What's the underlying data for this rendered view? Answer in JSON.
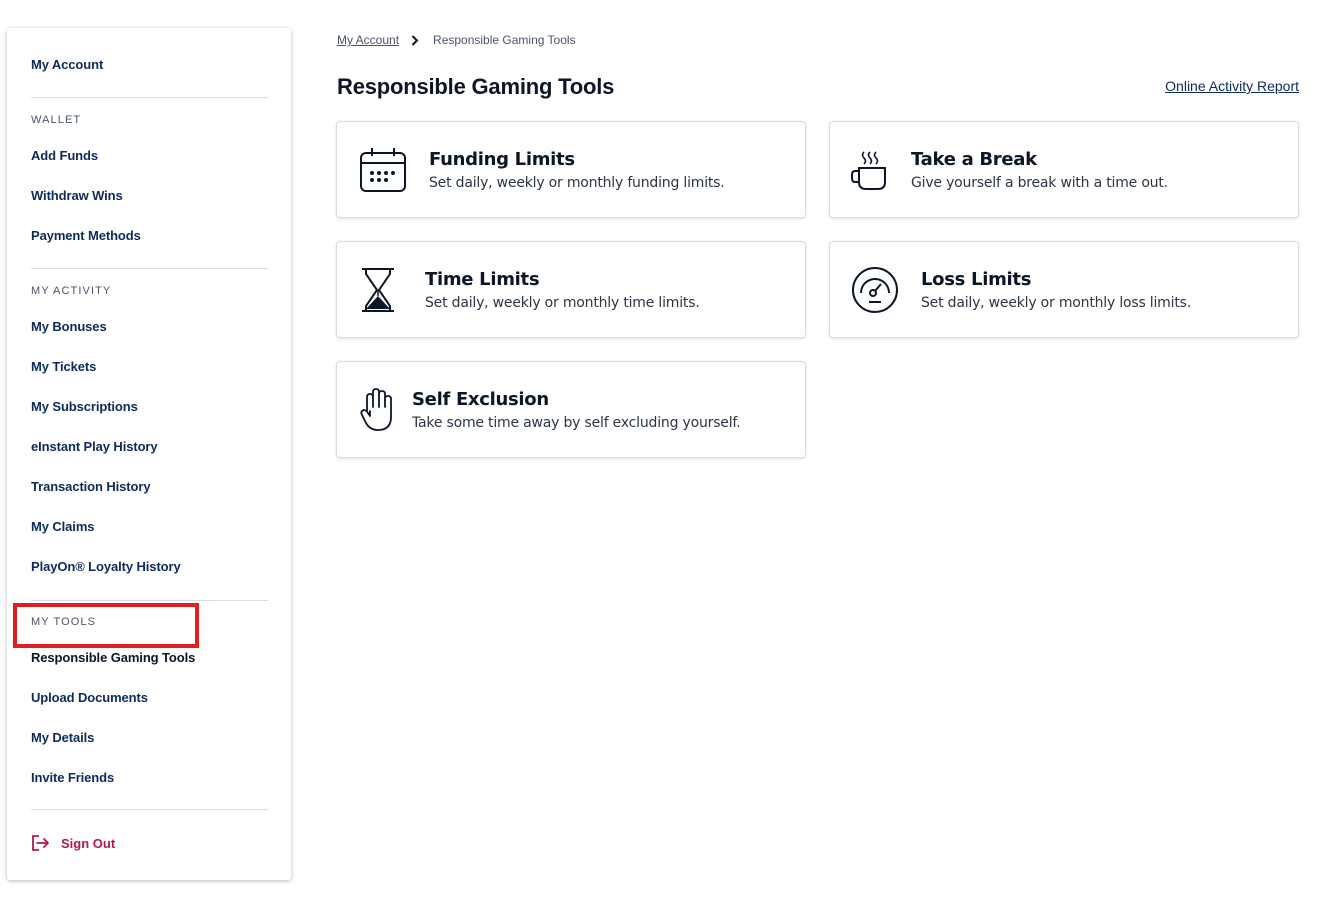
{
  "sidebar": {
    "my_account": "My Account",
    "wallet_heading": "WALLET",
    "wallet_items": [
      "Add Funds",
      "Withdraw Wins",
      "Payment Methods"
    ],
    "activity_heading": "MY ACTIVITY",
    "activity_items": [
      "My Bonuses",
      "My Tickets",
      "My Subscriptions",
      "eInstant Play History",
      "Transaction History",
      "My Claims",
      "PlayOn® Loyalty History"
    ],
    "tools_heading": "MY TOOLS",
    "tools_items": [
      "Responsible Gaming Tools",
      "Upload Documents",
      "My Details",
      "Invite Friends"
    ],
    "sign_out": "Sign Out",
    "active_item": "Responsible Gaming Tools"
  },
  "breadcrumb": {
    "parent": "My Account",
    "current": "Responsible Gaming Tools"
  },
  "main": {
    "title": "Responsible Gaming Tools",
    "report_link": "Online Activity Report",
    "cards": [
      {
        "title": "Funding Limits",
        "desc": "Set daily, weekly or monthly funding limits.",
        "icon": "calendar-icon"
      },
      {
        "title": "Take a Break",
        "desc": "Give yourself a break with a time out.",
        "icon": "coffee-cup-icon"
      },
      {
        "title": "Time Limits",
        "desc": "Set daily, weekly or monthly time limits.",
        "icon": "hourglass-icon"
      },
      {
        "title": "Loss Limits",
        "desc": "Set daily, weekly or monthly loss limits.",
        "icon": "gauge-icon"
      },
      {
        "title": "Self Exclusion",
        "desc": "Take some time away by self excluding yourself.",
        "icon": "hand-icon"
      }
    ]
  },
  "colors": {
    "accent_red": "#e02020",
    "sign_out": "#b3174d",
    "nav_text": "#0d2a5c"
  }
}
